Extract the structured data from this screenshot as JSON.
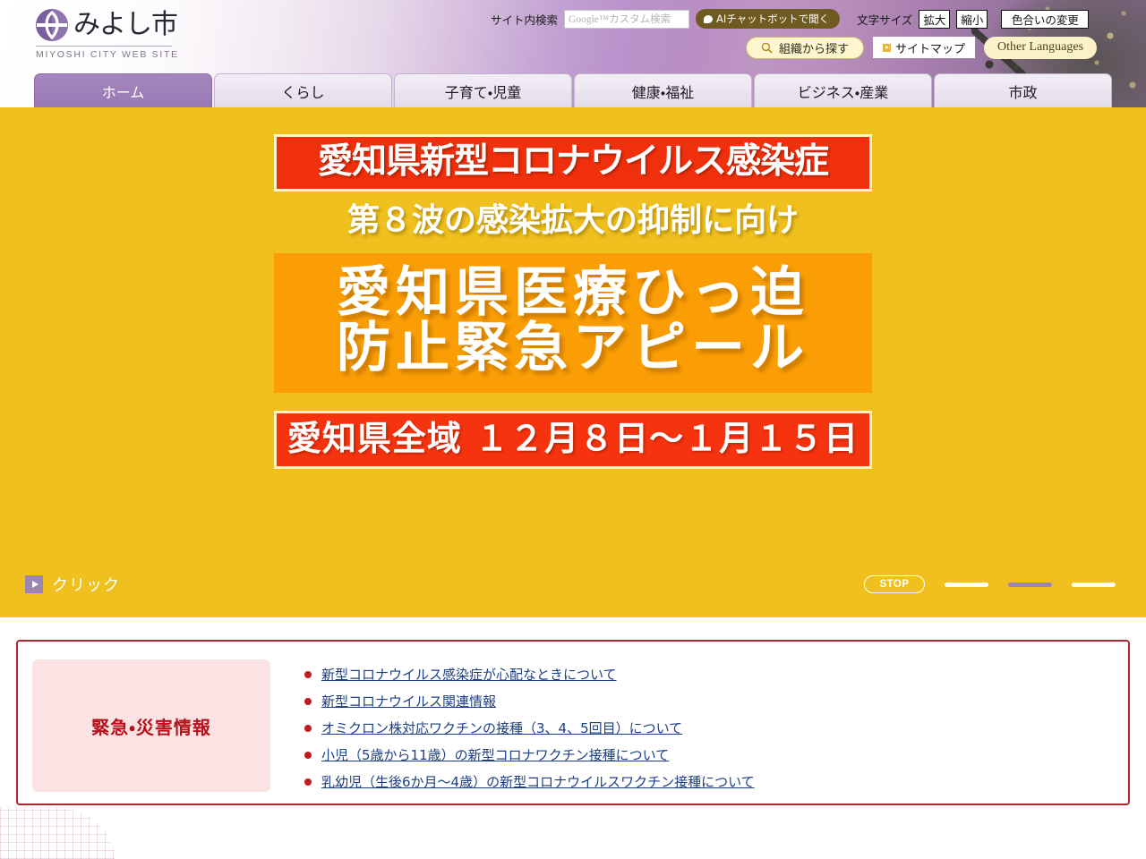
{
  "site": {
    "logo_text": "みよし市",
    "logo_sub": "MIYOSHI CITY WEB SITE"
  },
  "header": {
    "search_label": "サイト内検索",
    "search_placeholder": "Google™カスタム検索",
    "search_value": "",
    "chatbot_label": "AIチャットボットで聞く",
    "fontsize_label": "文字サイズ",
    "fontsize_up": "拡大",
    "fontsize_down": "縮小",
    "color_change": "色合いの変更",
    "org_search": "組織から探す",
    "sitemap": "サイトマップ",
    "other_languages": "Other Languages"
  },
  "gnav": [
    {
      "label": "ホーム",
      "active": true
    },
    {
      "label": "くらし",
      "active": false
    },
    {
      "label": "子育て・児童",
      "active": false
    },
    {
      "label": "健康・福祉",
      "active": false
    },
    {
      "label": "ビジネス・産業",
      "active": false
    },
    {
      "label": "市政",
      "active": false
    }
  ],
  "hero": {
    "band_top": "愛知県新型コロナウイルス感染症",
    "sub": "第８波の感染拡大の抑制に向け",
    "main_line1": "愛知県医療ひっ迫",
    "main_line2": "防止緊急アピール",
    "band_bottom": "愛知県全域 １２月８日～１月１５日",
    "click_text": "クリック",
    "stop_label": "STOP",
    "slides_total": 3,
    "active_slide": 2,
    "bg_color": "#efc01e",
    "band_red_color": "#f0300c",
    "band_orange_color": "#fb9e05"
  },
  "emergency": {
    "badge_label": "緊急・災害情報",
    "border_color": "#b22430",
    "links": [
      "新型コロナウイルス感染症が心配なときについて",
      "新型コロナウイルス関連情報",
      "オミクロン株対応ワクチンの接種（3、4、5回目）について",
      "小児（5歳から11歳）の新型コロナワクチン接種について",
      "乳幼児（生後6か月～4歳）の新型コロナウイルスワクチン接種について"
    ]
  }
}
